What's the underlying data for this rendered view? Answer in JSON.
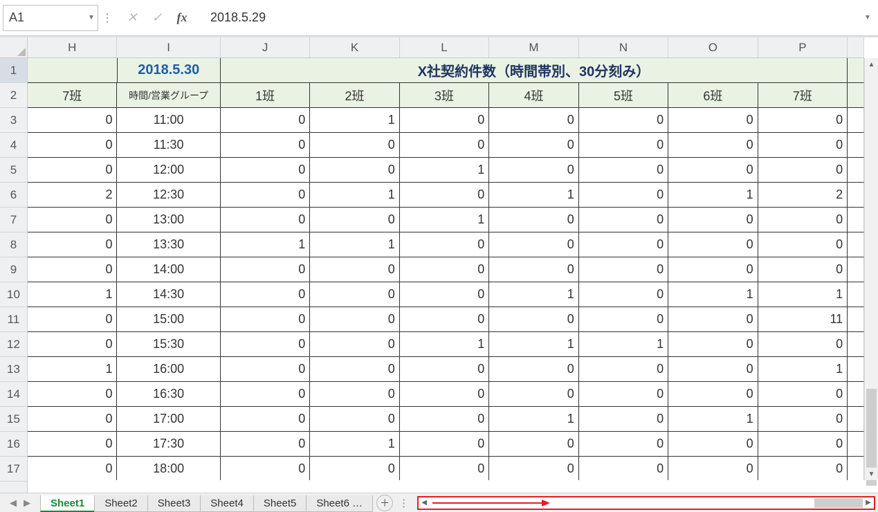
{
  "namebox": {
    "value": "A1"
  },
  "formula": {
    "value": "2018.5.29"
  },
  "columns": [
    "H",
    "I",
    "J",
    "K",
    "L",
    "M",
    "N",
    "O",
    "P"
  ],
  "row_headers": [
    1,
    2,
    3,
    4,
    5,
    6,
    7,
    8,
    9,
    10,
    11,
    12,
    13,
    14,
    15,
    16,
    17
  ],
  "row1": {
    "H": "",
    "date": "2018.5.30",
    "title": "X社契約件数（時間帯別、30分刻み）"
  },
  "row2": {
    "H": "7班",
    "I": "時間/営業グループ",
    "J": "1班",
    "K": "2班",
    "L": "3班",
    "M": "4班",
    "N": "5班",
    "O": "6班",
    "P": "7班"
  },
  "data_rows": [
    {
      "H": 0,
      "I": "11:00",
      "J": 0,
      "K": 1,
      "L": 0,
      "M": 0,
      "N": 0,
      "O": 0,
      "P": 0
    },
    {
      "H": 0,
      "I": "11:30",
      "J": 0,
      "K": 0,
      "L": 0,
      "M": 0,
      "N": 0,
      "O": 0,
      "P": 0
    },
    {
      "H": 0,
      "I": "12:00",
      "J": 0,
      "K": 0,
      "L": 1,
      "M": 0,
      "N": 0,
      "O": 0,
      "P": 0
    },
    {
      "H": 2,
      "I": "12:30",
      "J": 0,
      "K": 1,
      "L": 0,
      "M": 1,
      "N": 0,
      "O": 1,
      "P": 2
    },
    {
      "H": 0,
      "I": "13:00",
      "J": 0,
      "K": 0,
      "L": 1,
      "M": 0,
      "N": 0,
      "O": 0,
      "P": 0
    },
    {
      "H": 0,
      "I": "13:30",
      "J": 1,
      "K": 1,
      "L": 0,
      "M": 0,
      "N": 0,
      "O": 0,
      "P": 0
    },
    {
      "H": 0,
      "I": "14:00",
      "J": 0,
      "K": 0,
      "L": 0,
      "M": 0,
      "N": 0,
      "O": 0,
      "P": 0
    },
    {
      "H": 1,
      "I": "14:30",
      "J": 0,
      "K": 0,
      "L": 0,
      "M": 1,
      "N": 0,
      "O": 1,
      "P": 1
    },
    {
      "H": 0,
      "I": "15:00",
      "J": 0,
      "K": 0,
      "L": 0,
      "M": 0,
      "N": 0,
      "O": 0,
      "P": 11
    },
    {
      "H": 0,
      "I": "15:30",
      "J": 0,
      "K": 0,
      "L": 1,
      "M": 1,
      "N": 1,
      "O": 0,
      "P": 0
    },
    {
      "H": 1,
      "I": "16:00",
      "J": 0,
      "K": 0,
      "L": 0,
      "M": 0,
      "N": 0,
      "O": 0,
      "P": 1
    },
    {
      "H": 0,
      "I": "16:30",
      "J": 0,
      "K": 0,
      "L": 0,
      "M": 0,
      "N": 0,
      "O": 0,
      "P": 0
    },
    {
      "H": 0,
      "I": "17:00",
      "J": 0,
      "K": 0,
      "L": 0,
      "M": 1,
      "N": 0,
      "O": 1,
      "P": 0
    },
    {
      "H": 0,
      "I": "17:30",
      "J": 0,
      "K": 1,
      "L": 0,
      "M": 0,
      "N": 0,
      "O": 0,
      "P": 0
    },
    {
      "H": 0,
      "I": "18:00",
      "J": 0,
      "K": 0,
      "L": 0,
      "M": 0,
      "N": 0,
      "O": 0,
      "P": 0
    }
  ],
  "tabs": [
    "Sheet1",
    "Sheet2",
    "Sheet3",
    "Sheet4",
    "Sheet5",
    "Sheet6 …"
  ],
  "active_tab": "Sheet1"
}
